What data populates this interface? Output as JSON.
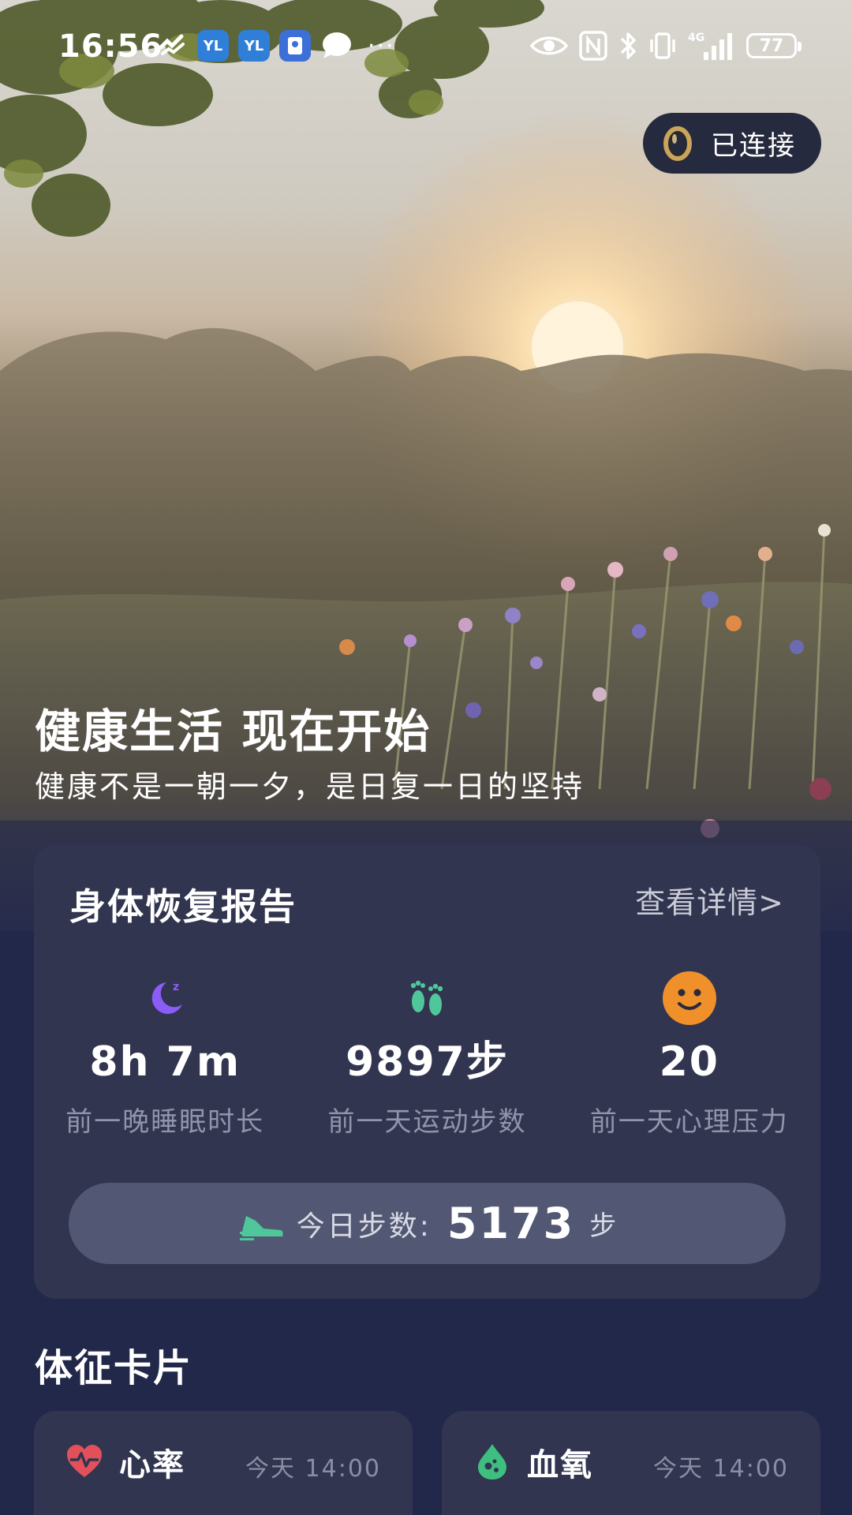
{
  "status_bar": {
    "time": "16:56",
    "notification_icons": [
      "heart-rate-app-icon",
      "app-icon-yl",
      "app-icon-yl",
      "note-app-icon",
      "message-icon"
    ],
    "more_indicator": "···",
    "system_icons": [
      "eye-comfort-icon",
      "nfc-icon",
      "bluetooth-icon",
      "vibrate-icon",
      "signal-4g-icon"
    ],
    "network_label": "4G",
    "battery": "77"
  },
  "device": {
    "status_label": "已连接",
    "icon": "ring-icon"
  },
  "hero": {
    "title": "健康生活 现在开始",
    "subtitle": "健康不是一朝一夕，是日复一日的坚持"
  },
  "report": {
    "title": "身体恢复报告",
    "link_label": "查看详情>",
    "metrics": [
      {
        "icon": "moon-sleep-icon",
        "value": "8h 7m",
        "label": "前一晚睡眠时长",
        "color": "#8b5cf6"
      },
      {
        "icon": "footprints-icon",
        "value": "9897步",
        "label": "前一天运动步数",
        "color": "#4fc79a"
      },
      {
        "icon": "smiley-face-icon",
        "value": "20",
        "label": "前一天心理压力",
        "color": "#f0902a"
      }
    ],
    "today_steps": {
      "icon": "sneaker-icon",
      "label": "今日步数:",
      "value": "5173",
      "unit": "步"
    }
  },
  "vitals": {
    "section_title": "体征卡片",
    "cards": [
      {
        "icon": "heart-rate-icon",
        "name": "心率",
        "time": "今天 14:00",
        "color": "#e2505a"
      },
      {
        "icon": "blood-oxygen-drop-icon",
        "name": "血氧",
        "time": "今天 14:00",
        "color": "#3fbf7f"
      }
    ]
  }
}
